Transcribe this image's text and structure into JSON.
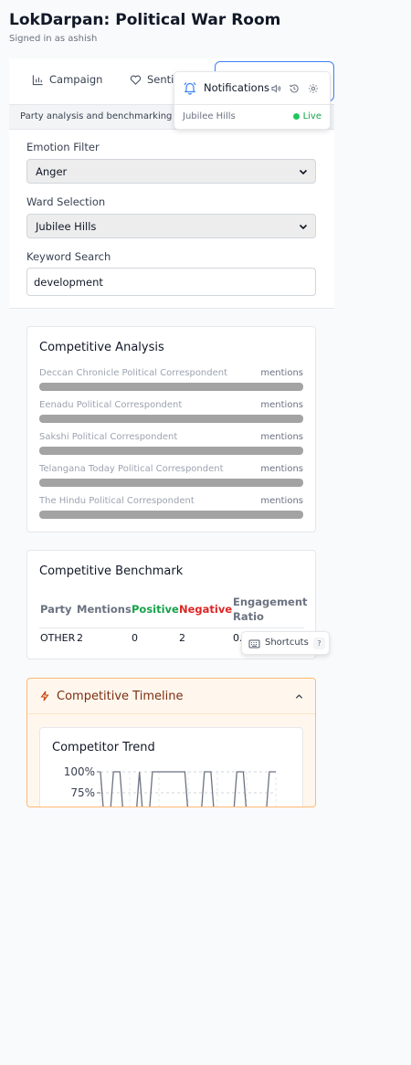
{
  "header": {
    "title": "LokDarpan: Political War Room",
    "signed_in": "Signed in as ashish"
  },
  "tabs": [
    {
      "label": "Campaign",
      "icon": "bar-chart-icon"
    },
    {
      "label": "Senti",
      "icon": "heart-icon"
    }
  ],
  "subtitle": "Party analysis and benchmarking",
  "filters": {
    "emotion_label": "Emotion Filter",
    "emotion_value": "Anger",
    "ward_label": "Ward Selection",
    "ward_value": "Jubilee Hills",
    "keyword_label": "Keyword Search",
    "keyword_value": "development"
  },
  "competitive_analysis": {
    "title": "Competitive Analysis",
    "items": [
      {
        "label": "Deccan Chronicle Political Correspondent",
        "suffix": "mentions",
        "fill": 1.0
      },
      {
        "label": "Eenadu Political Correspondent",
        "suffix": "mentions",
        "fill": 1.0
      },
      {
        "label": "Sakshi Political Correspondent",
        "suffix": "mentions",
        "fill": 1.0
      },
      {
        "label": "Telangana Today Political Correspondent",
        "suffix": "mentions",
        "fill": 1.0
      },
      {
        "label": "The Hindu Political Correspondent",
        "suffix": "mentions",
        "fill": 1.0
      }
    ]
  },
  "benchmark": {
    "title": "Competitive Benchmark",
    "headers": {
      "party": "Party",
      "mentions": "Mentions",
      "positive": "Positive",
      "negative": "Negative",
      "engagement_line1": "Engagement",
      "engagement_line2": "Ratio"
    },
    "rows": [
      {
        "party": "OTHER",
        "mentions": "2",
        "positive": "0",
        "negative": "2",
        "ratio": "0."
      }
    ],
    "colors": {
      "positive": "#16a34a",
      "negative": "#dc2626"
    }
  },
  "timeline": {
    "title": "Competitive Timeline",
    "trend_title": "Competitor Trend"
  },
  "chart_data": {
    "type": "line",
    "title": "Competitor Trend",
    "yticks": [
      "100%",
      "75%"
    ],
    "ylim": [
      0,
      1
    ],
    "grid": true,
    "series": [
      {
        "values": [
          1,
          0,
          1,
          1,
          0,
          0,
          1,
          0,
          1,
          1,
          1,
          1,
          1,
          1,
          0,
          0,
          1,
          1,
          0,
          0,
          0,
          1,
          1,
          0,
          0,
          0,
          1,
          1
        ]
      }
    ]
  },
  "notifications": {
    "title": "Notifications",
    "ward": "Jubilee Hills",
    "status": "Live",
    "icons": [
      "bell-icon",
      "sound-icon",
      "history-icon",
      "settings-icon"
    ]
  },
  "shortcuts": {
    "label": "Shortcuts",
    "key": "?"
  }
}
